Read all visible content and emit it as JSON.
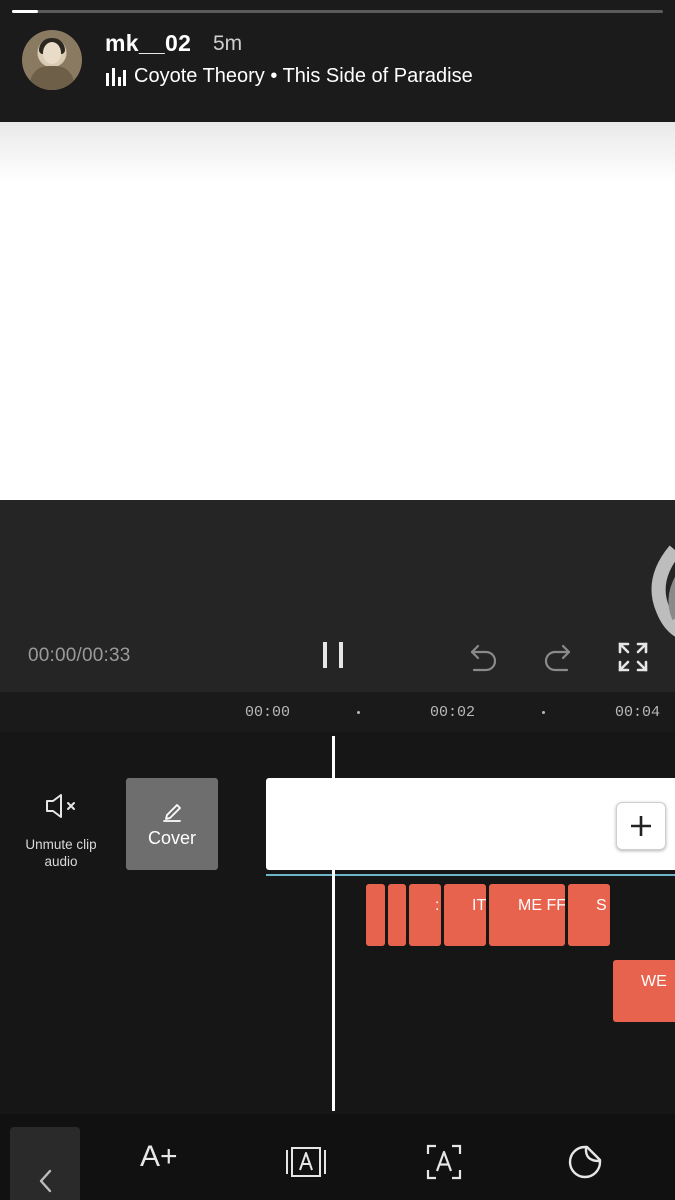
{
  "story": {
    "username": "mk__02",
    "timestamp": "5m",
    "progress": 0.04,
    "music": {
      "artist": "Coyote Theory",
      "separator": "•",
      "song": "This Side of Paradise"
    }
  },
  "player": {
    "time_display": "00:00/00:33",
    "play_state": "playing"
  },
  "timeline": {
    "ruler_labels": [
      "00:00",
      "00:02",
      "00:04"
    ],
    "unmute_label": "Unmute clip audio",
    "cover_label": "Cover",
    "text_clips": [
      {
        "label": ""
      },
      {
        "label": ""
      },
      {
        "label": ":"
      },
      {
        "label": "IT"
      },
      {
        "label": "ME FF"
      },
      {
        "label": "S"
      }
    ],
    "text_clip_second_row": "WE"
  },
  "toolbar": {
    "text_add_label": "A+",
    "icons": [
      "back-icon",
      "add-text-icon",
      "text-template-icon",
      "auto-caption-icon",
      "sticker-icon"
    ]
  },
  "colors": {
    "text_clip": "#e8634d",
    "accent_line": "#6fb7c8",
    "background": "#161616"
  }
}
